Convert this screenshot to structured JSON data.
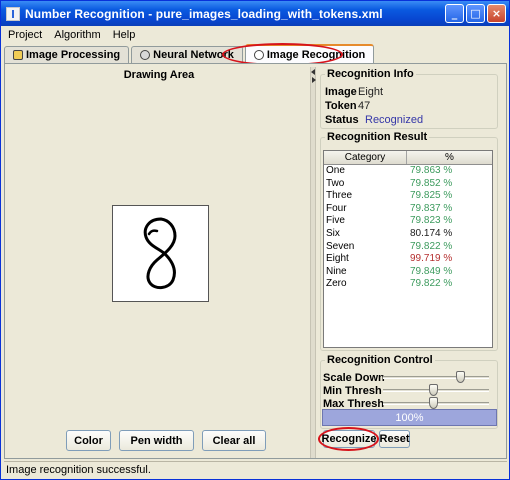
{
  "window": {
    "title": "Number Recognition - pure_images_loading_with_tokens.xml"
  },
  "menu": {
    "items": [
      "Project",
      "Algorithm",
      "Help"
    ]
  },
  "tabs": [
    {
      "label": "Image Processing",
      "icon": "image-processing-icon"
    },
    {
      "label": "Neural Network",
      "icon": "gear-icon"
    },
    {
      "label": "Image Recognition",
      "icon": "magnifier-icon",
      "active": true
    }
  ],
  "drawing": {
    "title": "Drawing Area",
    "digit": "8",
    "buttons": {
      "color": "Color",
      "pen_width": "Pen width",
      "clear_all": "Clear all"
    }
  },
  "recognition_info": {
    "title": "Recognition Info",
    "image_label": "Image",
    "image_value": "Eight",
    "token_label": "Token",
    "token_value": "47",
    "status_label": "Status",
    "status_value": "Recognized"
  },
  "recognition_result": {
    "title": "Recognition Result",
    "columns": [
      "Category",
      "%"
    ],
    "rows": [
      {
        "category": "One",
        "percent": "79.863 %",
        "color": "#3d9b5e"
      },
      {
        "category": "Two",
        "percent": "79.852 %",
        "color": "#3d9b5e"
      },
      {
        "category": "Three",
        "percent": "79.825 %",
        "color": "#3d9b5e"
      },
      {
        "category": "Four",
        "percent": "79.837 %",
        "color": "#3d9b5e"
      },
      {
        "category": "Five",
        "percent": "79.823 %",
        "color": "#3d9b5e"
      },
      {
        "category": "Six",
        "percent": "80.174 %",
        "color": "#1b1b1b"
      },
      {
        "category": "Seven",
        "percent": "79.822 %",
        "color": "#3d9b5e"
      },
      {
        "category": "Eight",
        "percent": "99.719 %",
        "color": "#b52f2f"
      },
      {
        "category": "Nine",
        "percent": "79.849 %",
        "color": "#3d9b5e"
      },
      {
        "category": "Zero",
        "percent": "79.822 %",
        "color": "#3d9b5e"
      }
    ]
  },
  "recognition_control": {
    "title": "Recognition Control",
    "sliders": [
      {
        "label": "Scale Down",
        "value": 0.75
      },
      {
        "label": "Min Thresh",
        "value": 0.47
      },
      {
        "label": "Max Thresh",
        "value": 0.47
      }
    ],
    "progress": {
      "label": "100%",
      "value": 1.0
    },
    "buttons": {
      "recognize": "Recognize",
      "reset": "Reset"
    }
  },
  "status_bar": {
    "message": "Image recognition successful."
  },
  "colors": {
    "title_bar": "#0a5ae0",
    "highlight": "#d6131b",
    "status_recognized": "#3436a8"
  }
}
